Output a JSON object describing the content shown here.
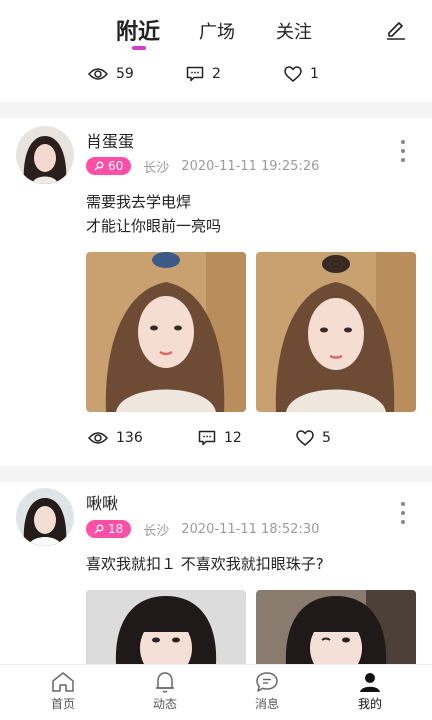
{
  "header": {
    "tabs": [
      {
        "label": "附近",
        "active": true
      },
      {
        "label": "广场",
        "active": false
      },
      {
        "label": "关注",
        "active": false
      }
    ],
    "accent_color": "#d43bd0"
  },
  "prev_post_stats": {
    "views": "59",
    "comments": "2",
    "likes": "1"
  },
  "posts": [
    {
      "username": "肖蛋蛋",
      "badge_value": "60",
      "location": "长沙",
      "timestamp": "2020-11-11 19:25:26",
      "content": "需要我去学电焊\n才能让你眼前一亮吗",
      "stats": {
        "views": "136",
        "comments": "12",
        "likes": "5"
      }
    },
    {
      "username": "啾啾",
      "badge_value": "18",
      "location": "长沙",
      "timestamp": "2020-11-11 18:52:30",
      "content": "喜欢我就扣１ 不喜欢我就扣眼珠子?"
    }
  ],
  "bottom_nav": [
    {
      "label": "首页",
      "icon": "home-icon",
      "active": false
    },
    {
      "label": "动态",
      "icon": "bell-icon",
      "active": false
    },
    {
      "label": "消息",
      "icon": "message-icon",
      "active": false
    },
    {
      "label": "我的",
      "icon": "profile-icon",
      "active": true
    }
  ],
  "badge_color": "#ff4fa7"
}
